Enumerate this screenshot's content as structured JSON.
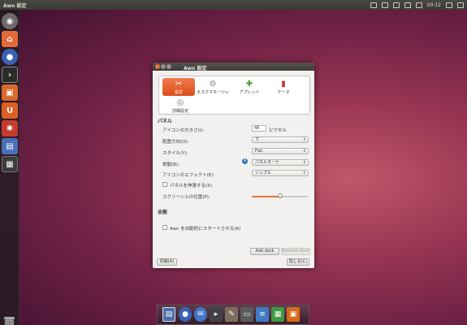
{
  "topbar": {
    "title": "Awn 設定",
    "clock": "00:12",
    "tray_icons": [
      "keyboard-icon",
      "mail-icon",
      "network-icon",
      "bluetooth-icon",
      "volume-icon",
      "user-icon",
      "power-icon"
    ]
  },
  "launcher": {
    "items": [
      {
        "name": "ubuntu-logo-icon",
        "color": "#6f6a6c"
      },
      {
        "name": "home-folder-icon",
        "color": "#e36a3b"
      },
      {
        "name": "firefox-icon",
        "color": "#3a62b4"
      },
      {
        "name": "terminal-icon",
        "color": "#2b2b2b"
      },
      {
        "name": "software-center-icon",
        "color": "#d56b2d"
      },
      {
        "name": "ubuntu-one-icon",
        "color": "#dc5f24"
      },
      {
        "name": "settings-icon",
        "color": "#c43b2e"
      },
      {
        "name": "awn-settings-icon",
        "color": "#4a6fb6"
      },
      {
        "name": "workspace-icon",
        "color": "#3c3c3c"
      }
    ]
  },
  "window": {
    "title": "Awn 設定",
    "tabs": [
      {
        "label": "設定",
        "icon": "tools-icon",
        "glyph": "✂",
        "active": true
      },
      {
        "label": "タスクマネージャ",
        "icon": "task-manager-icon",
        "glyph": "⚙",
        "active": false
      },
      {
        "label": "アプレット",
        "icon": "applets-icon",
        "glyph": "✚",
        "active": false
      },
      {
        "label": "テーマ",
        "icon": "themes-icon",
        "glyph": "▮",
        "active": false
      },
      {
        "label": "詳細設定",
        "icon": "advanced-icon",
        "glyph": "◎",
        "active": false
      }
    ],
    "panel_section": "パネル",
    "icon_size_label": "アイコンの大きさ(I):",
    "icon_size_value": "48",
    "icon_size_unit": "ピクセル",
    "orientation_label": "配置方向(O):",
    "orientation_value": "下",
    "style_label": "スタイル(Y):",
    "style_value": "Flat",
    "behavior_label": "挙動(B):",
    "behavior_value": "パネルモード",
    "effect_label": "アイコンのエフェクト(E):",
    "effect_value": "シンプル",
    "expand_label": "パネルを伸張する(X)",
    "expand_checked": false,
    "position_label": "スクリーン上の位置(P):",
    "position_fraction": 0.5,
    "general_section": "全般",
    "autostart_label": "Awn を自動的にスタートさせる(A)",
    "autostart_checked": false,
    "add_dock_button": "Add dock",
    "remove_dock_button": "Remove dock",
    "help_button": "情報(A)",
    "close_button": "閉じる(C)"
  },
  "dock": {
    "items": [
      {
        "name": "awn-settings-dock-icon",
        "color": "#4c6fae"
      },
      {
        "name": "firefox-dock-icon",
        "color": "#3a62b4"
      },
      {
        "name": "thunderbird-dock-icon",
        "color": "#3f78c8"
      },
      {
        "name": "shotwell-dock-icon",
        "color": "#3e4247"
      },
      {
        "name": "gimp-dock-icon",
        "color": "#7b6f5d"
      },
      {
        "name": "scanner-dock-icon",
        "color": "#5b5b5b"
      },
      {
        "name": "writer-dock-icon",
        "color": "#3f7ac2"
      },
      {
        "name": "calc-dock-icon",
        "color": "#3f9a42"
      },
      {
        "name": "impress-dock-icon",
        "color": "#d66a1c"
      }
    ]
  }
}
